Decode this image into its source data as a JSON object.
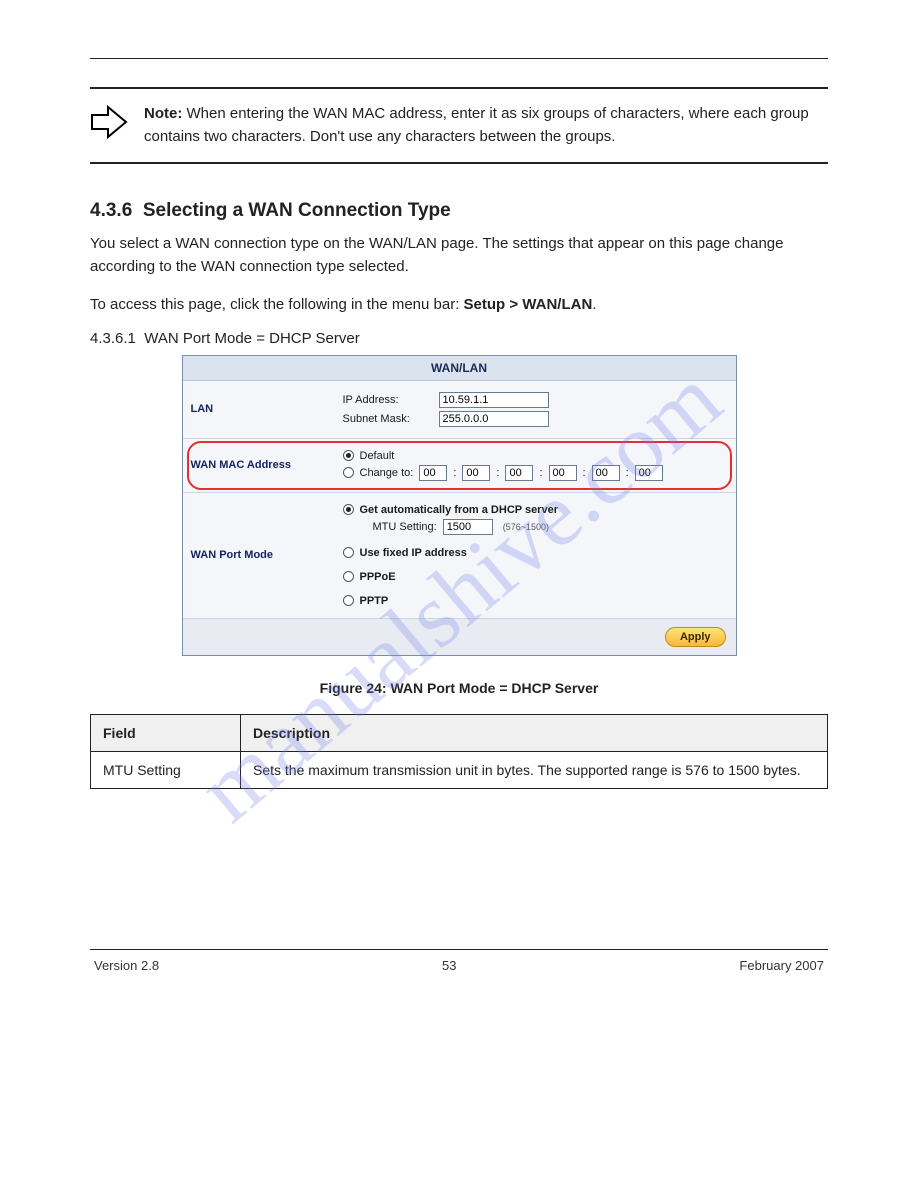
{
  "watermark": "manualshive.com",
  "header_spacer": "",
  "note": {
    "label": "Note: ",
    "text": "When entering the WAN MAC address, enter it as six groups of characters, where each group contains two characters. Don't use any characters between the groups."
  },
  "section": {
    "number": "4.3.6",
    "title": "Selecting a WAN Connection Type",
    "intro": "You select a WAN connection type on the WAN/LAN page. The settings that appear on this page change according to the WAN connection type selected.",
    "nav": "To access this page, click the following in the menu bar: ",
    "nav_path": "Setup > WAN/LAN",
    "subhead_prefix": "4.3.6.1",
    "subhead_text": "WAN Port Mode = DHCP Server"
  },
  "ui": {
    "title": "WAN/LAN",
    "lan": {
      "label": "LAN",
      "ip_label": "IP Address:",
      "ip_value": "10.59.1.1",
      "mask_label": "Subnet Mask:",
      "mask_value": "255.0.0.0"
    },
    "mac": {
      "label": "WAN MAC Address",
      "default_label": "Default",
      "change_label": "Change to:",
      "octets": [
        "00",
        "00",
        "00",
        "00",
        "00",
        "00"
      ]
    },
    "wan": {
      "label": "WAN Port Mode",
      "dhcp_label": "Get automatically from a DHCP server",
      "mtu_label": "MTU Setting:",
      "mtu_value": "1500",
      "mtu_range": "(576~1500)",
      "fixed_label": "Use fixed IP address",
      "pppoe_label": "PPPoE",
      "pptp_label": "PPTP"
    },
    "apply": "Apply"
  },
  "figure": {
    "caption": "Figure 24: WAN Port Mode = DHCP Server"
  },
  "table": {
    "head_field": "Field",
    "head_desc": "Description",
    "row1_field": "MTU Setting",
    "row1_desc": "Sets the maximum transmission unit in bytes. The supported range is 576 to 1500 bytes."
  },
  "footer": {
    "left": "Version 2.8",
    "center": "53",
    "right": "February 2007"
  }
}
